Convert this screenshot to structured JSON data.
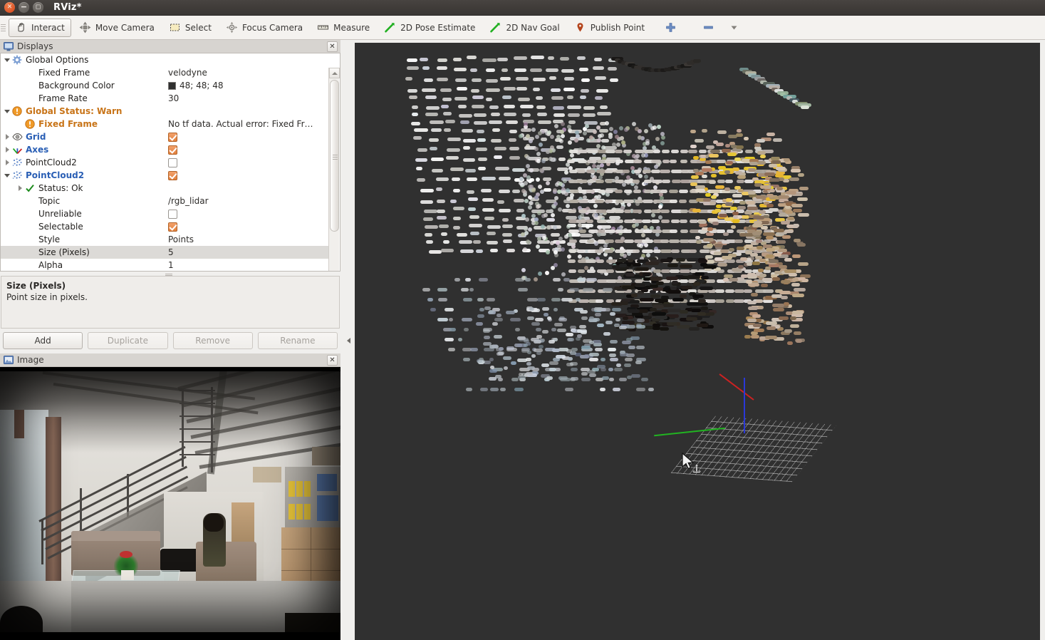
{
  "window": {
    "title": "RViz*",
    "buttons": {
      "close": "close-button",
      "minimize": "minimize-button",
      "maximize": "maximize-button"
    }
  },
  "toolbar": {
    "items": [
      {
        "label": "Interact",
        "icon": "hand-cursor-icon",
        "active": true
      },
      {
        "label": "Move Camera",
        "icon": "move-camera-icon",
        "active": false
      },
      {
        "label": "Select",
        "icon": "select-rect-icon",
        "active": false
      },
      {
        "label": "Focus Camera",
        "icon": "focus-camera-icon",
        "active": false
      },
      {
        "label": "Measure",
        "icon": "ruler-icon",
        "active": false
      },
      {
        "label": "2D Pose Estimate",
        "icon": "green-arrow-icon",
        "active": false
      },
      {
        "label": "2D Nav Goal",
        "icon": "green-arrow-icon",
        "active": false
      },
      {
        "label": "Publish Point",
        "icon": "map-pin-icon",
        "active": false
      }
    ],
    "add_tool_icon": "plus-icon",
    "remove_tool_icon": "minus-icon",
    "overflow_icon": "chevron-down-icon"
  },
  "displays": {
    "panel_title": "Displays",
    "panel_icon": "monitor-icon",
    "close_icon": "close-icon",
    "tree": [
      {
        "indent": 0,
        "expander": "down",
        "icon": "gear-icon",
        "label": "Global Options",
        "style": "plain",
        "value_type": "none",
        "value": ""
      },
      {
        "indent": 1,
        "expander": "none",
        "icon": "none",
        "label": "Fixed Frame",
        "style": "plain",
        "value_type": "text",
        "value": "velodyne"
      },
      {
        "indent": 1,
        "expander": "none",
        "icon": "none",
        "label": "Background Color",
        "style": "plain",
        "value_type": "color",
        "value": "48; 48; 48",
        "swatch": "#303030"
      },
      {
        "indent": 1,
        "expander": "none",
        "icon": "none",
        "label": "Frame Rate",
        "style": "plain",
        "value_type": "text",
        "value": "30"
      },
      {
        "indent": 0,
        "expander": "down",
        "icon": "warning-icon",
        "label": "Global Status: Warn",
        "style": "orange",
        "value_type": "none",
        "value": ""
      },
      {
        "indent": 1,
        "expander": "none",
        "icon": "warning-icon",
        "label": "Fixed Frame",
        "style": "orange",
        "value_type": "text",
        "value": "No tf data.  Actual error: Fixed Fr…"
      },
      {
        "indent": 0,
        "expander": "right",
        "icon": "eye-icon",
        "label": "Grid",
        "style": "blue",
        "value_type": "checkbox",
        "value": "checked"
      },
      {
        "indent": 0,
        "expander": "right",
        "icon": "axes-icon",
        "label": "Axes",
        "style": "blue",
        "value_type": "checkbox",
        "value": "checked"
      },
      {
        "indent": 0,
        "expander": "right",
        "icon": "pointcloud-icon",
        "label": "PointCloud2",
        "style": "plain",
        "value_type": "checkbox",
        "value": "unchecked"
      },
      {
        "indent": 0,
        "expander": "down",
        "icon": "pointcloud-icon",
        "label": "PointCloud2",
        "style": "blue",
        "value_type": "checkbox",
        "value": "checked"
      },
      {
        "indent": 1,
        "expander": "right",
        "icon": "check-icon",
        "label": "Status: Ok",
        "style": "plain",
        "value_type": "none",
        "value": ""
      },
      {
        "indent": 1,
        "expander": "none",
        "icon": "none",
        "label": "Topic",
        "style": "plain",
        "value_type": "text",
        "value": "/rgb_lidar"
      },
      {
        "indent": 1,
        "expander": "none",
        "icon": "none",
        "label": "Unreliable",
        "style": "plain",
        "value_type": "checkbox",
        "value": "unchecked"
      },
      {
        "indent": 1,
        "expander": "none",
        "icon": "none",
        "label": "Selectable",
        "style": "plain",
        "value_type": "checkbox",
        "value": "checked"
      },
      {
        "indent": 1,
        "expander": "none",
        "icon": "none",
        "label": "Style",
        "style": "plain",
        "value_type": "text",
        "value": "Points"
      },
      {
        "indent": 1,
        "expander": "none",
        "icon": "none",
        "label": "Size (Pixels)",
        "style": "plain",
        "value_type": "text",
        "value": "5",
        "selected": true
      },
      {
        "indent": 1,
        "expander": "none",
        "icon": "none",
        "label": "Alpha",
        "style": "plain",
        "value_type": "text",
        "value": "1"
      }
    ],
    "description": {
      "title": "Size (Pixels)",
      "body": "Point size in pixels."
    },
    "buttons": [
      {
        "label": "Add",
        "enabled": true
      },
      {
        "label": "Duplicate",
        "enabled": false
      },
      {
        "label": "Remove",
        "enabled": false
      },
      {
        "label": "Rename",
        "enabled": false
      }
    ]
  },
  "image_panel": {
    "panel_title": "Image",
    "panel_icon": "image-icon",
    "close_icon": "close-icon",
    "scene_description": "Indoor lobby with metal staircase, sofa, glass coffee table, seated person and bookshelves"
  },
  "view3d": {
    "background_color": "#303030",
    "fixed_frame": "velodyne",
    "axis_colors": {
      "x": "#cc2222",
      "y": "#21b421",
      "z": "#2a38d8"
    },
    "cursor_icon": "arrow-cursor-icon",
    "secondary_cursor_icon": "move-camera-cursor-icon"
  },
  "collapse_handle": {
    "icon": "chevron-left-icon"
  }
}
